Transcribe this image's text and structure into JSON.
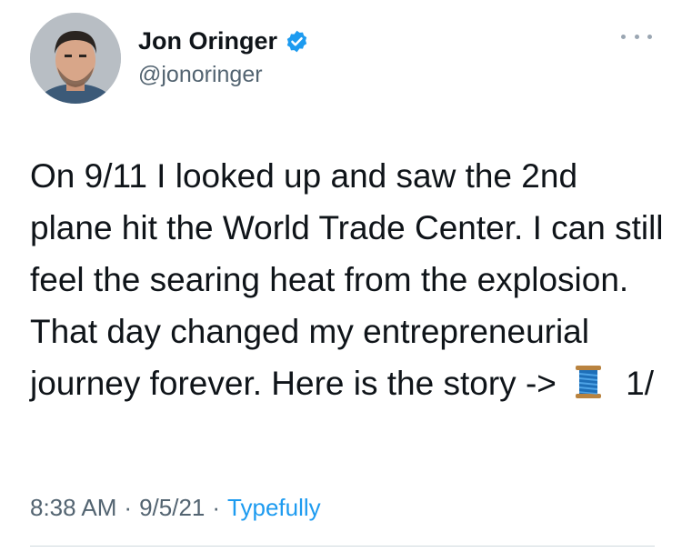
{
  "author": {
    "display_name": "Jon Oringer",
    "handle": "@jonoringer",
    "verified": true,
    "avatar_icon": "profile-photo"
  },
  "tweet": {
    "text_before_icon": "On 9/11 I looked up and saw the 2nd plane hit the World Trade Center. I can still feel the searing heat from the explosion. That day changed my entrepreneurial journey forever. Here is the story -> ",
    "inline_icon": "thread-spool-emoji",
    "text_after_icon": "1/"
  },
  "meta": {
    "time": "8:38 AM",
    "separator": "·",
    "date": "9/5/21",
    "source": "Typefully"
  },
  "colors": {
    "link": "#1d9bf0",
    "muted": "#536471",
    "verified": "#1d9bf0"
  }
}
